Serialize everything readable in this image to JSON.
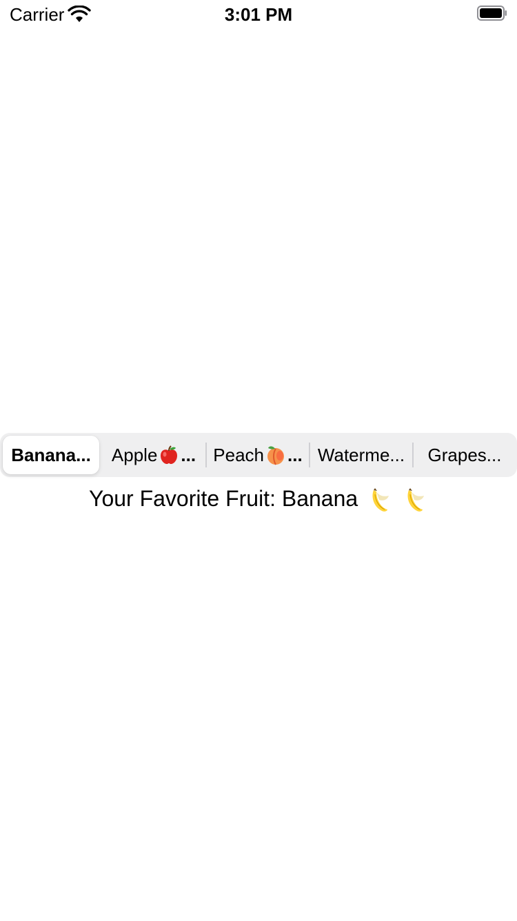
{
  "status_bar": {
    "carrier": "Carrier",
    "time": "3:01 PM",
    "icons": [
      "wifi-icon",
      "battery-icon"
    ]
  },
  "segmented_control": {
    "selected_index": 0,
    "segments": [
      {
        "label": "Banana...",
        "emoji": null
      },
      {
        "label": "Apple",
        "emoji": "apple-icon",
        "suffix": "..."
      },
      {
        "label": "Peach",
        "emoji": "peach-icon",
        "suffix": "..."
      },
      {
        "label": "Waterme...",
        "emoji": null
      },
      {
        "label": "Grapes...",
        "emoji": null
      }
    ]
  },
  "result": {
    "prefix": "Your Favorite Fruit: Banana",
    "emojis": [
      "banana-icon",
      "banana-icon"
    ]
  },
  "colors": {
    "segmented_background": "#efeff0",
    "selected_segment": "#ffffff",
    "divider": "#cfcfd3"
  }
}
